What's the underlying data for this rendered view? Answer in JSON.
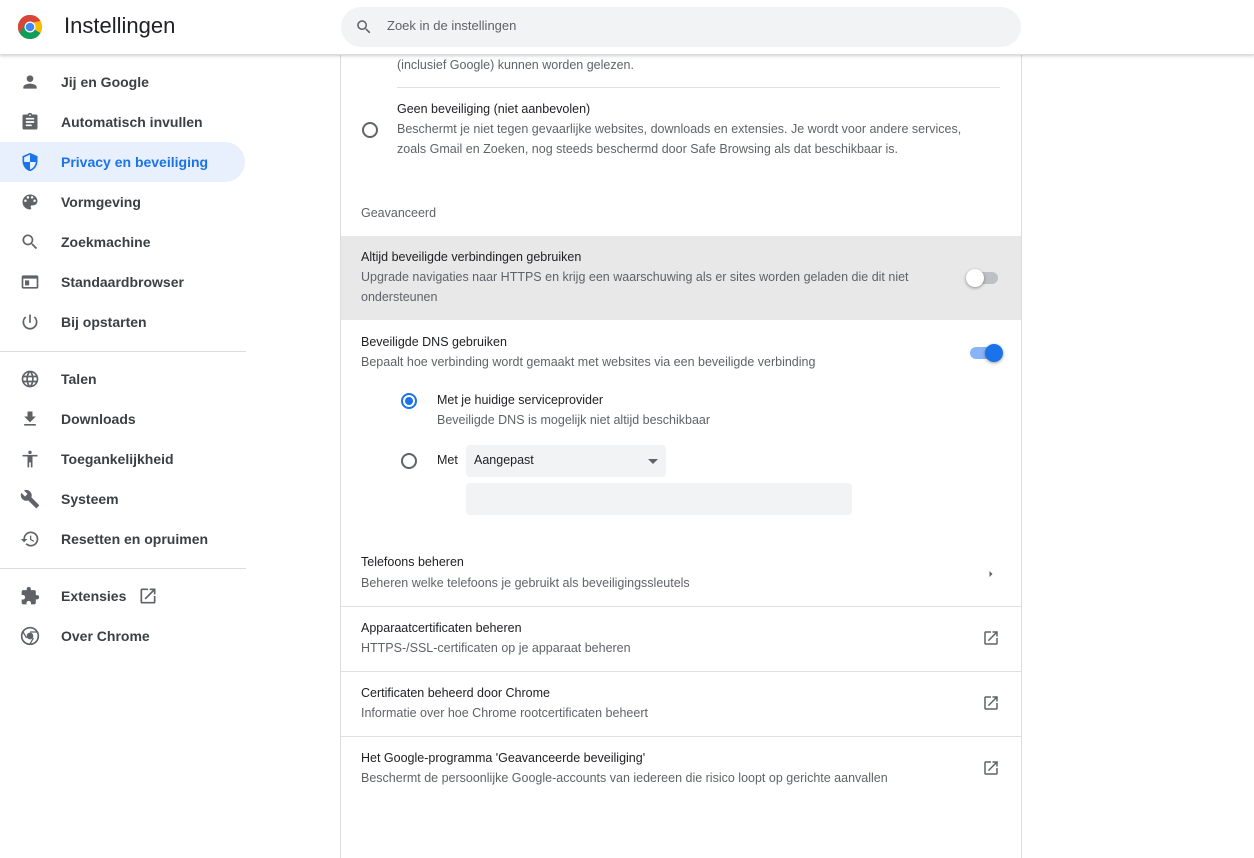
{
  "header": {
    "title": "Instellingen",
    "search_placeholder": "Zoek in de instellingen"
  },
  "sidebar": {
    "items": [
      {
        "label": "Jij en Google",
        "icon": "person-icon"
      },
      {
        "label": "Automatisch invullen",
        "icon": "clipboard-icon"
      },
      {
        "label": "Privacy en beveiliging",
        "icon": "shield-icon",
        "active": true
      },
      {
        "label": "Vormgeving",
        "icon": "palette-icon"
      },
      {
        "label": "Zoekmachine",
        "icon": "search-icon"
      },
      {
        "label": "Standaardbrowser",
        "icon": "browser-icon"
      },
      {
        "label": "Bij opstarten",
        "icon": "power-icon"
      },
      {
        "label": "Talen",
        "icon": "globe-icon"
      },
      {
        "label": "Downloads",
        "icon": "download-icon"
      },
      {
        "label": "Toegankelijkheid",
        "icon": "accessibility-icon"
      },
      {
        "label": "Systeem",
        "icon": "wrench-icon"
      },
      {
        "label": "Resetten en opruimen",
        "icon": "history-icon"
      },
      {
        "label": "Extensies",
        "icon": "puzzle-icon"
      },
      {
        "label": "Over Chrome",
        "icon": "chrome-icon"
      }
    ]
  },
  "main": {
    "top_partial_text": "(inclusief Google) kunnen worden gelezen.",
    "no_protection": {
      "title": "Geen beveiliging (niet aanbevolen)",
      "desc_line1": "Beschermt je niet tegen gevaarlijke websites, downloads en extensies. Je wordt voor andere services,",
      "desc_line2": "zoals Gmail en Zoeken, nog steeds beschermd door Safe Browsing als dat beschikbaar is.",
      "selected": false
    },
    "advanced_heading": "Geavanceerd",
    "https_only": {
      "title": "Altijd beveiligde verbindingen gebruiken",
      "desc_line1": "Upgrade navigaties naar HTTPS en krijg een waarschuwing als er sites worden geladen die dit niet",
      "desc_line2": "ondersteunen",
      "enabled": false
    },
    "secure_dns": {
      "title": "Beveiligde DNS gebruiken",
      "desc": "Bepaalt hoe verbinding wordt gemaakt met websites via een beveiligde verbinding",
      "enabled": true,
      "option_current": {
        "title": "Met je huidige serviceprovider",
        "desc": "Beveiligde DNS is mogelijk niet altijd beschikbaar",
        "selected": true
      },
      "option_custom": {
        "label": "Met",
        "select_value": "Aangepast",
        "selected": false,
        "input_value": ""
      }
    },
    "rows": [
      {
        "title": "Telefoons beheren",
        "desc": "Beheren welke telefoons je gebruikt als beveiligingssleutels",
        "action": "chevron-right-icon"
      },
      {
        "title": "Apparaatcertificaten beheren",
        "desc": "HTTPS-/SSL-certificaten op je apparaat beheren",
        "action": "open-external-icon"
      },
      {
        "title": "Certificaten beheerd door Chrome",
        "desc": "Informatie over hoe Chrome rootcertificaten beheert",
        "action": "open-external-icon"
      },
      {
        "title": "Het Google-programma 'Geavanceerde beveiliging'",
        "desc": "Beschermt de persoonlijke Google-accounts van iedereen die risico loopt op gerichte aanvallen",
        "action": "open-external-icon"
      }
    ]
  },
  "colors": {
    "accent": "#1a73e8",
    "active_nav_bg": "#e8f0fe",
    "highlight_row": "#e8e8e8"
  }
}
